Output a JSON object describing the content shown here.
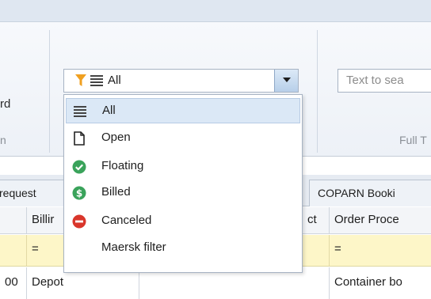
{
  "ribbon": {
    "left_button_fragment": "rd",
    "left_group_fragment": "n",
    "fulltext_group_fragment": "Full T"
  },
  "filter_combo": {
    "value": "All"
  },
  "search": {
    "placeholder": "Text to sea"
  },
  "dropdown": {
    "items": [
      {
        "label": "All",
        "icon": "list-lines-icon",
        "selected": true
      },
      {
        "label": "Open",
        "icon": "document-icon"
      },
      {
        "label": "Floating",
        "icon": "check-circle-icon",
        "color": "#3aa35b"
      },
      {
        "label": "Billed",
        "icon": "dollar-circle-icon",
        "color": "#3aa35b"
      },
      {
        "label": "Canceled",
        "icon": "no-entry-icon",
        "color": "#d9362b"
      },
      {
        "label": "Maersk filter",
        "icon": ""
      }
    ]
  },
  "tabs": [
    {
      "label": "request"
    },
    {
      "label": "COPARN Booki"
    }
  ],
  "grid": {
    "headers": [
      "",
      "Billir",
      "",
      "ct",
      "Order Proce"
    ],
    "filter_row": [
      "",
      "=",
      "",
      "",
      "="
    ],
    "rows": [
      [
        "00",
        "Depot",
        "",
        "",
        "Container bo"
      ]
    ]
  },
  "colors": {
    "accent": "#4a86c8",
    "filter_row": "#fdf6c8",
    "selection": "#dbe8f6",
    "funnel": "#f0a020"
  }
}
